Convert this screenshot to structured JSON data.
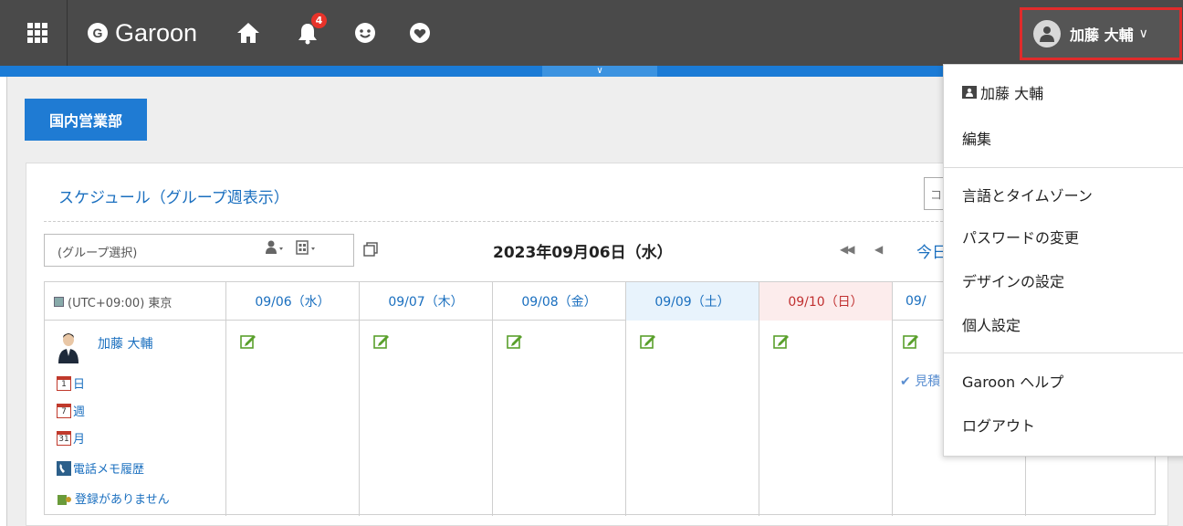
{
  "header": {
    "app_name": "Garoon",
    "logo_letter": "G",
    "notification_count": "4",
    "user_name": "加藤 大輔",
    "icons": [
      "apps-grid-icon",
      "home-icon",
      "bell-icon",
      "smiley-icon",
      "favorite-icon"
    ]
  },
  "group_button": "国内営業部",
  "schedule": {
    "title": "スケジュール（グループ週表示）",
    "search_stub": "コ",
    "group_select_value": "(グループ選択)",
    "date_title": "2023年09月06日（水）",
    "nav_prevprev": "◀◀",
    "nav_prev": "◀",
    "nav_today": "今日",
    "timezone": "(UTC+09:00) 東京",
    "days": [
      "09/06（水）",
      "09/07（木）",
      "09/08（金）",
      "09/09（土）",
      "09/10（日）",
      "09/"
    ],
    "user": {
      "name": "加藤 大輔",
      "links": [
        {
          "icon_text": "1",
          "label": "日"
        },
        {
          "icon_text": "7",
          "label": "週"
        },
        {
          "icon_text": "31",
          "label": "月"
        },
        {
          "label": "電話メモ履歴"
        },
        {
          "label": "登録がありません"
        }
      ]
    },
    "partial_event": "見積",
    "colors": {
      "saturday_bg": "#e8f3fc",
      "sunday_bg": "#fcecec",
      "link": "#1a6fbf"
    }
  },
  "user_menu": {
    "items": [
      {
        "label": "加藤 大輔"
      },
      {
        "label": "編集"
      },
      {
        "label": "言語とタイムゾーン"
      },
      {
        "label": "パスワードの変更"
      },
      {
        "label": "デザインの設定"
      },
      {
        "label": "個人設定"
      },
      {
        "label": "Garoon ヘルプ"
      },
      {
        "label": "ログアウト"
      }
    ]
  }
}
